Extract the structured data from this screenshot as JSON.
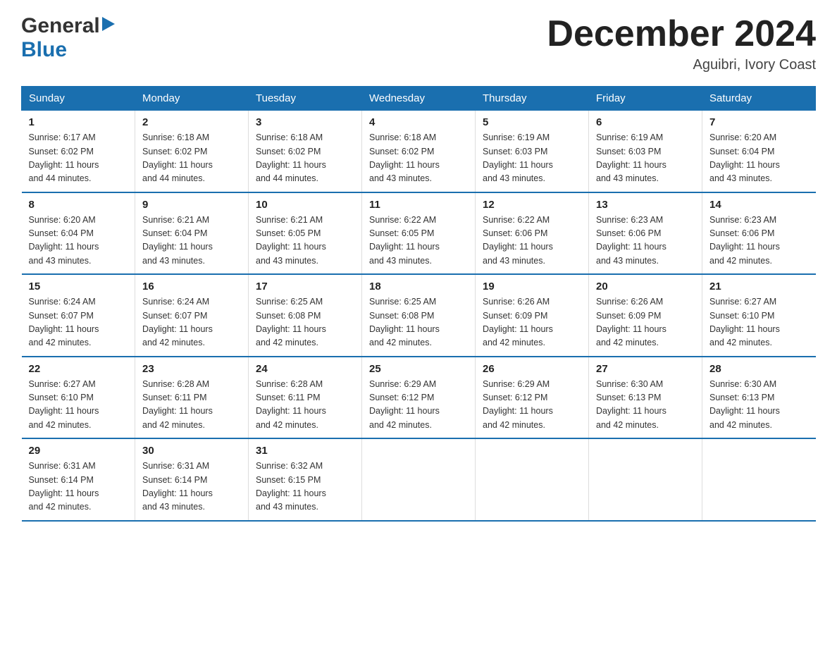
{
  "logo": {
    "general": "General",
    "blue": "Blue",
    "arrow": "▶"
  },
  "title": "December 2024",
  "location": "Aguibri, Ivory Coast",
  "weekdays": [
    "Sunday",
    "Monday",
    "Tuesday",
    "Wednesday",
    "Thursday",
    "Friday",
    "Saturday"
  ],
  "weeks": [
    [
      {
        "day": "1",
        "sunrise": "6:17 AM",
        "sunset": "6:02 PM",
        "daylight": "11 hours and 44 minutes."
      },
      {
        "day": "2",
        "sunrise": "6:18 AM",
        "sunset": "6:02 PM",
        "daylight": "11 hours and 44 minutes."
      },
      {
        "day": "3",
        "sunrise": "6:18 AM",
        "sunset": "6:02 PM",
        "daylight": "11 hours and 44 minutes."
      },
      {
        "day": "4",
        "sunrise": "6:18 AM",
        "sunset": "6:02 PM",
        "daylight": "11 hours and 43 minutes."
      },
      {
        "day": "5",
        "sunrise": "6:19 AM",
        "sunset": "6:03 PM",
        "daylight": "11 hours and 43 minutes."
      },
      {
        "day": "6",
        "sunrise": "6:19 AM",
        "sunset": "6:03 PM",
        "daylight": "11 hours and 43 minutes."
      },
      {
        "day": "7",
        "sunrise": "6:20 AM",
        "sunset": "6:04 PM",
        "daylight": "11 hours and 43 minutes."
      }
    ],
    [
      {
        "day": "8",
        "sunrise": "6:20 AM",
        "sunset": "6:04 PM",
        "daylight": "11 hours and 43 minutes."
      },
      {
        "day": "9",
        "sunrise": "6:21 AM",
        "sunset": "6:04 PM",
        "daylight": "11 hours and 43 minutes."
      },
      {
        "day": "10",
        "sunrise": "6:21 AM",
        "sunset": "6:05 PM",
        "daylight": "11 hours and 43 minutes."
      },
      {
        "day": "11",
        "sunrise": "6:22 AM",
        "sunset": "6:05 PM",
        "daylight": "11 hours and 43 minutes."
      },
      {
        "day": "12",
        "sunrise": "6:22 AM",
        "sunset": "6:06 PM",
        "daylight": "11 hours and 43 minutes."
      },
      {
        "day": "13",
        "sunrise": "6:23 AM",
        "sunset": "6:06 PM",
        "daylight": "11 hours and 43 minutes."
      },
      {
        "day": "14",
        "sunrise": "6:23 AM",
        "sunset": "6:06 PM",
        "daylight": "11 hours and 42 minutes."
      }
    ],
    [
      {
        "day": "15",
        "sunrise": "6:24 AM",
        "sunset": "6:07 PM",
        "daylight": "11 hours and 42 minutes."
      },
      {
        "day": "16",
        "sunrise": "6:24 AM",
        "sunset": "6:07 PM",
        "daylight": "11 hours and 42 minutes."
      },
      {
        "day": "17",
        "sunrise": "6:25 AM",
        "sunset": "6:08 PM",
        "daylight": "11 hours and 42 minutes."
      },
      {
        "day": "18",
        "sunrise": "6:25 AM",
        "sunset": "6:08 PM",
        "daylight": "11 hours and 42 minutes."
      },
      {
        "day": "19",
        "sunrise": "6:26 AM",
        "sunset": "6:09 PM",
        "daylight": "11 hours and 42 minutes."
      },
      {
        "day": "20",
        "sunrise": "6:26 AM",
        "sunset": "6:09 PM",
        "daylight": "11 hours and 42 minutes."
      },
      {
        "day": "21",
        "sunrise": "6:27 AM",
        "sunset": "6:10 PM",
        "daylight": "11 hours and 42 minutes."
      }
    ],
    [
      {
        "day": "22",
        "sunrise": "6:27 AM",
        "sunset": "6:10 PM",
        "daylight": "11 hours and 42 minutes."
      },
      {
        "day": "23",
        "sunrise": "6:28 AM",
        "sunset": "6:11 PM",
        "daylight": "11 hours and 42 minutes."
      },
      {
        "day": "24",
        "sunrise": "6:28 AM",
        "sunset": "6:11 PM",
        "daylight": "11 hours and 42 minutes."
      },
      {
        "day": "25",
        "sunrise": "6:29 AM",
        "sunset": "6:12 PM",
        "daylight": "11 hours and 42 minutes."
      },
      {
        "day": "26",
        "sunrise": "6:29 AM",
        "sunset": "6:12 PM",
        "daylight": "11 hours and 42 minutes."
      },
      {
        "day": "27",
        "sunrise": "6:30 AM",
        "sunset": "6:13 PM",
        "daylight": "11 hours and 42 minutes."
      },
      {
        "day": "28",
        "sunrise": "6:30 AM",
        "sunset": "6:13 PM",
        "daylight": "11 hours and 42 minutes."
      }
    ],
    [
      {
        "day": "29",
        "sunrise": "6:31 AM",
        "sunset": "6:14 PM",
        "daylight": "11 hours and 42 minutes."
      },
      {
        "day": "30",
        "sunrise": "6:31 AM",
        "sunset": "6:14 PM",
        "daylight": "11 hours and 43 minutes."
      },
      {
        "day": "31",
        "sunrise": "6:32 AM",
        "sunset": "6:15 PM",
        "daylight": "11 hours and 43 minutes."
      },
      null,
      null,
      null,
      null
    ]
  ],
  "labels": {
    "sunrise": "Sunrise:",
    "sunset": "Sunset:",
    "daylight": "Daylight:"
  }
}
